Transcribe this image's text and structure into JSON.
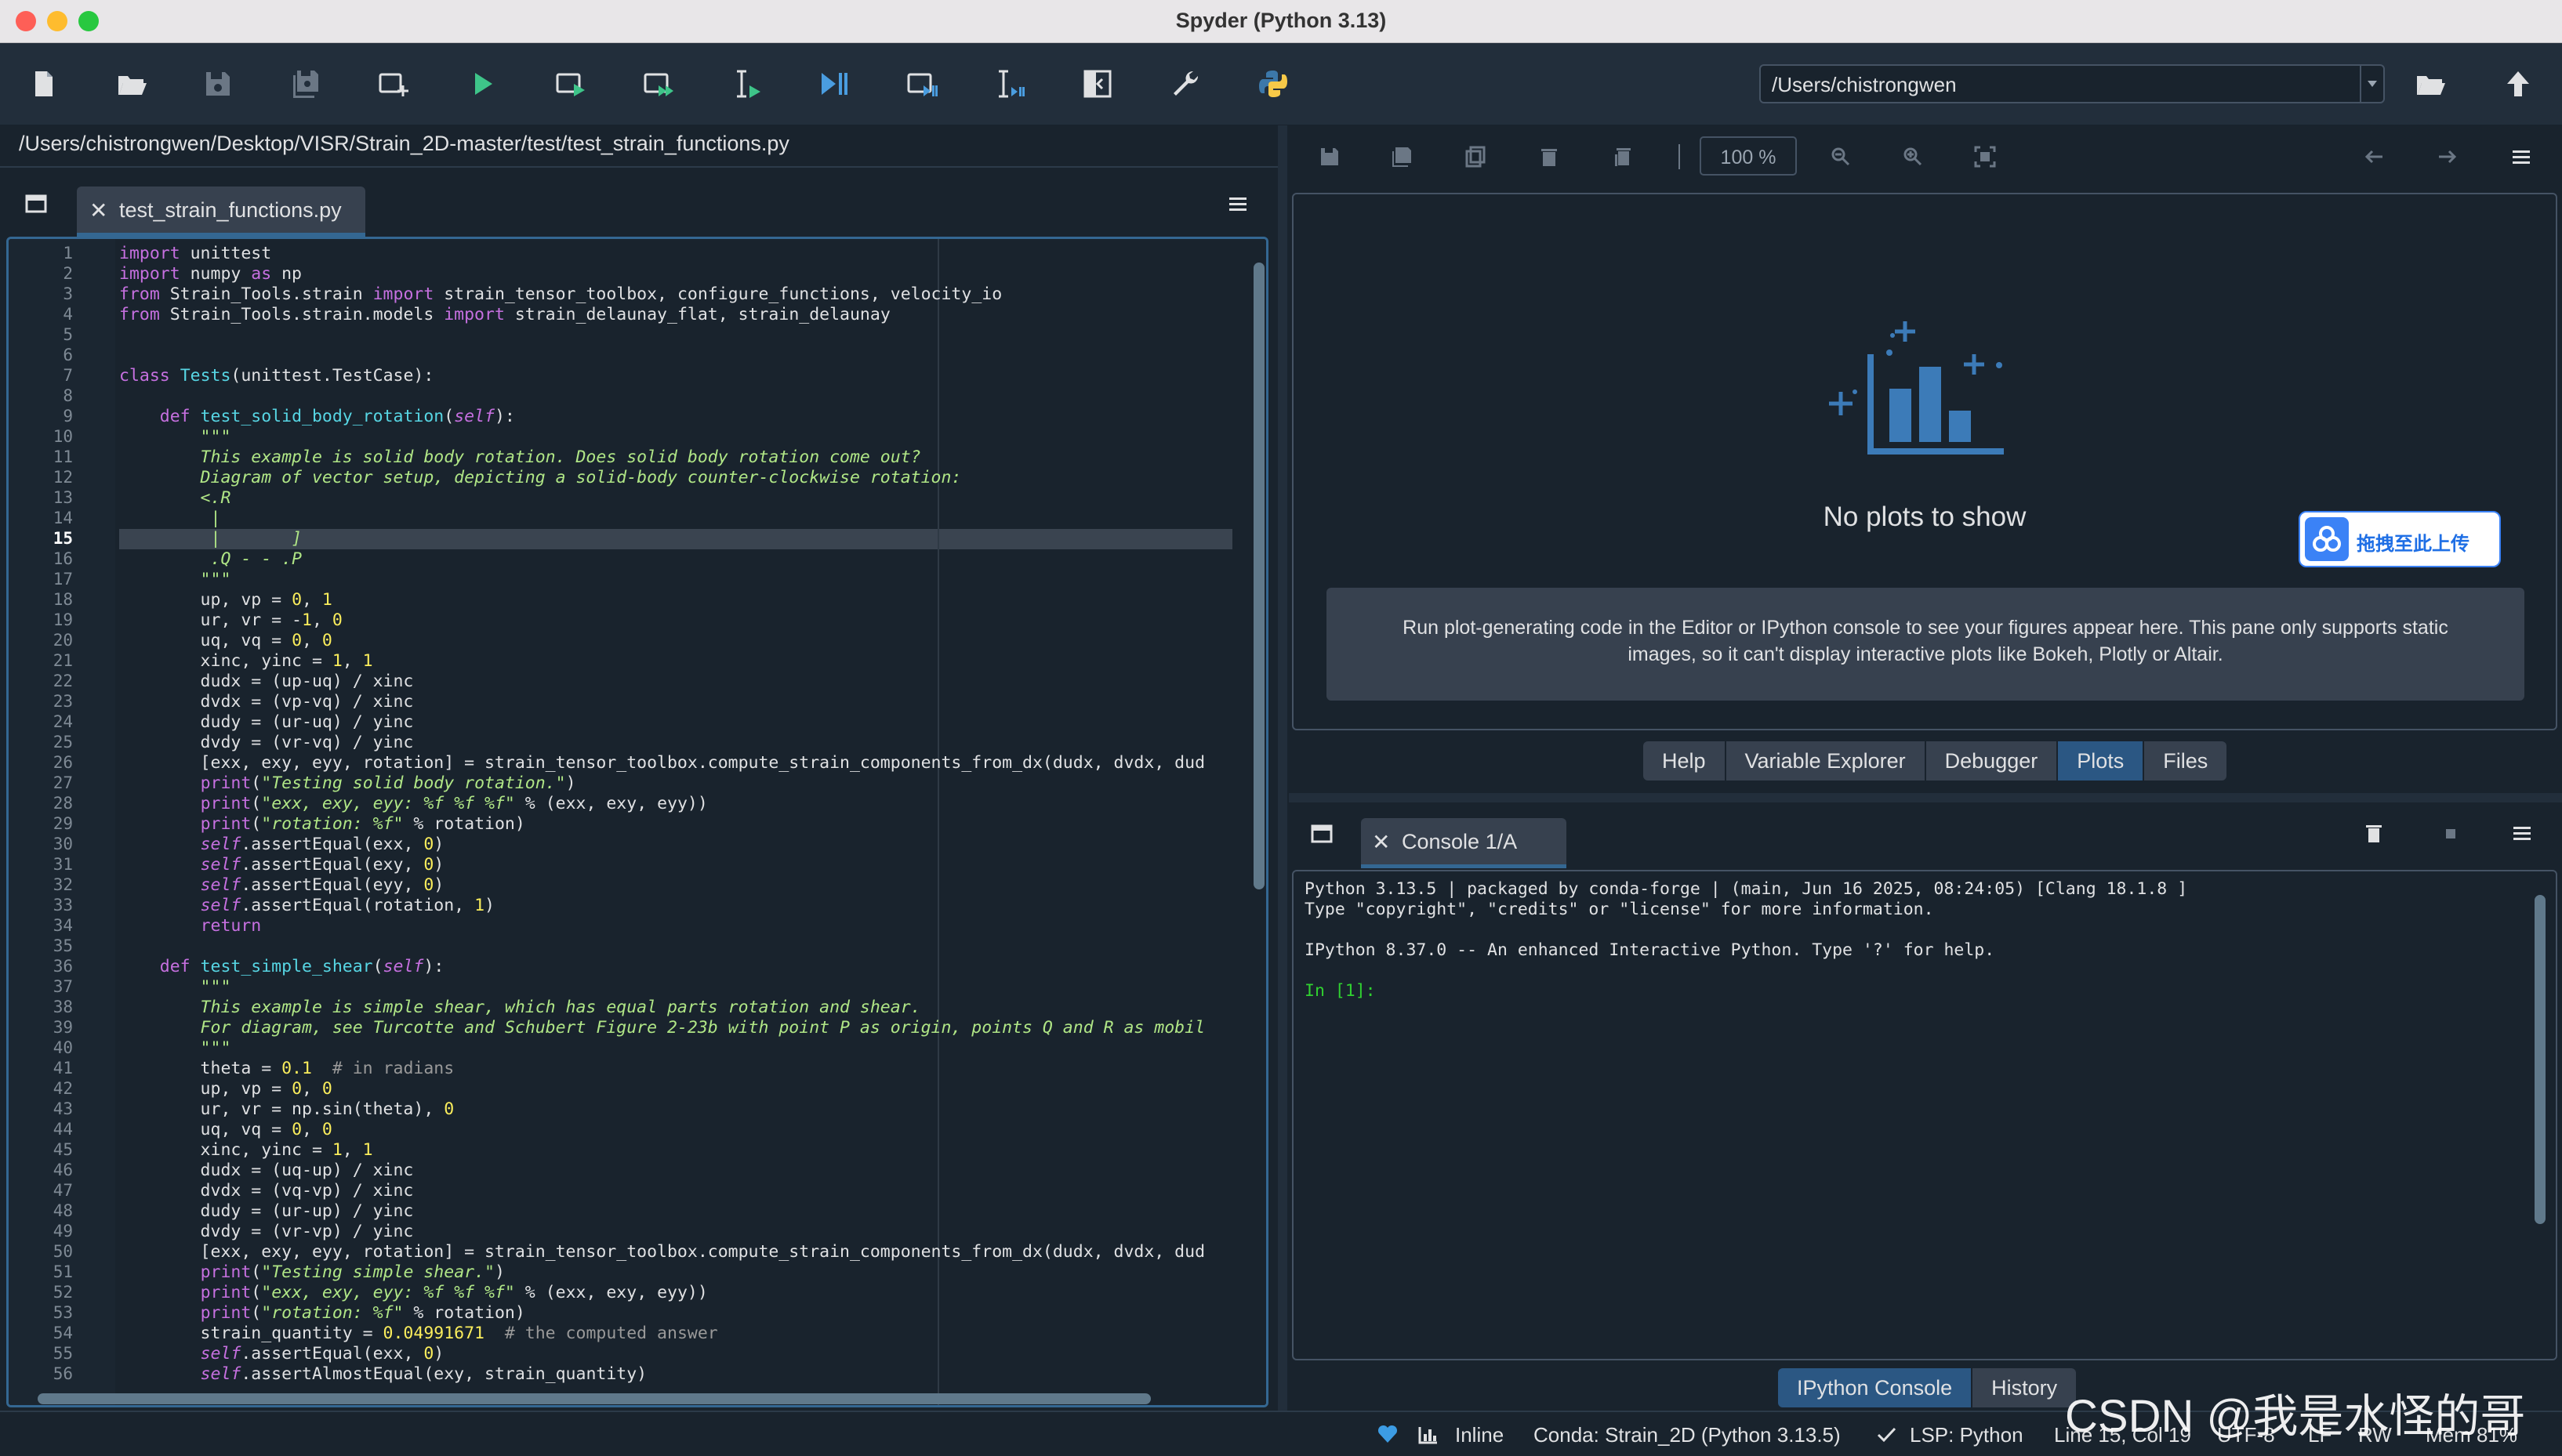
{
  "window": {
    "title": "Spyder (Python 3.13)"
  },
  "toolbar": {
    "icons": [
      "new-file-icon",
      "open-file-icon",
      "save-icon",
      "save-all-icon",
      "new-cell-icon",
      "run-icon",
      "run-cell-icon",
      "run-cell-advance-icon",
      "run-selection-icon",
      "debug-icon",
      "debug-cell-icon",
      "debug-selection-icon",
      "maximize-pane-icon",
      "preferences-wrench-icon",
      "python-path-icon",
      "open-folder-icon",
      "parent-directory-icon"
    ],
    "working_dir": "/Users/chistrongwen"
  },
  "editor": {
    "file_path": "/Users/chistrongwen/Desktop/VISR/Strain_2D-master/test/test_strain_functions.py",
    "tab_label": "test_strain_functions.py",
    "tab_close": "✕",
    "current_line": 15,
    "lines": [
      "import unittest",
      "import numpy as np",
      "from Strain_Tools.strain import strain_tensor_toolbox, configure_functions, velocity_io",
      "from Strain_Tools.strain.models import strain_delaunay_flat, strain_delaunay",
      "",
      "",
      "class Tests(unittest.TestCase):",
      "",
      "    def test_solid_body_rotation(self):",
      "        \"\"\"",
      "        This example is solid body rotation. Does solid body rotation come out?",
      "        Diagram of vector setup, depicting a solid-body counter-clockwise rotation:",
      "        <.R",
      "         |",
      "         |       ]",
      "         .Q - - .P",
      "        \"\"\"",
      "        up, vp = 0, 1",
      "        ur, vr = -1, 0",
      "        uq, vq = 0, 0",
      "        xinc, yinc = 1, 1",
      "        dudx = (up-uq) / xinc",
      "        dvdx = (vp-vq) / xinc",
      "        dudy = (ur-uq) / yinc",
      "        dvdy = (vr-vq) / yinc",
      "        [exx, exy, eyy, rotation] = strain_tensor_toolbox.compute_strain_components_from_dx(dudx, dvdx, dud",
      "        print(\"Testing solid body rotation.\")",
      "        print(\"exx, exy, eyy: %f %f %f\" % (exx, exy, eyy))",
      "        print(\"rotation: %f\" % rotation)",
      "        self.assertEqual(exx, 0)",
      "        self.assertEqual(exy, 0)",
      "        self.assertEqual(eyy, 0)",
      "        self.assertEqual(rotation, 1)",
      "        return",
      "",
      "    def test_simple_shear(self):",
      "        \"\"\"",
      "        This example is simple shear, which has equal parts rotation and shear.",
      "        For diagram, see Turcotte and Schubert Figure 2-23b with point P as origin, points Q and R as mobil",
      "        \"\"\"",
      "        theta = 0.1  # in radians",
      "        up, vp = 0, 0",
      "        ur, vr = np.sin(theta), 0",
      "        uq, vq = 0, 0",
      "        xinc, yinc = 1, 1",
      "        dudx = (uq-up) / xinc",
      "        dvdx = (vq-vp) / xinc",
      "        dudy = (ur-up) / yinc",
      "        dvdy = (vr-vp) / yinc",
      "        [exx, exy, eyy, rotation] = strain_tensor_toolbox.compute_strain_components_from_dx(dudx, dvdx, dud",
      "        print(\"Testing simple shear.\")",
      "        print(\"exx, exy, eyy: %f %f %f\" % (exx, exy, eyy))",
      "        print(\"rotation: %f\" % rotation)",
      "        strain_quantity = 0.04991671  # the computed answer",
      "        self.assertEqual(exx, 0)",
      "        self.assertAlmostEqual(exy, strain_quantity)"
    ]
  },
  "plots": {
    "zoom": "100 %",
    "empty_title": "No plots to show",
    "empty_message": "Run plot-generating code in the Editor or IPython console to see your figures appear here. This pane only supports static images, so it can't display interactive plots like Bokeh, Plotly or Altair.",
    "upload_button": "拖拽至此上传",
    "tabs": [
      "Help",
      "Variable Explorer",
      "Debugger",
      "Plots",
      "Files"
    ],
    "selected_tab": "Plots"
  },
  "console": {
    "tab_label": "Console 1/A",
    "tab_close": "✕",
    "lines": [
      "Python 3.13.5 | packaged by conda-forge | (main, Jun 16 2025, 08:24:05) [Clang 18.1.8 ]",
      "Type \"copyright\", \"credits\" or \"license\" for more information.",
      "",
      "IPython 8.37.0 -- An enhanced Interactive Python. Type '?' for help.",
      "",
      "In [1]:"
    ],
    "tabs": [
      "IPython Console",
      "History"
    ],
    "selected_tab": "IPython Console"
  },
  "status": {
    "inline": "Inline",
    "conda": "Conda: Strain_2D (Python 3.13.5)",
    "lsp": "LSP: Python",
    "position": "Line 15, Col 19",
    "encoding": "UTF-8",
    "eol": "LF",
    "rw": "RW",
    "mem": "Mem 81%"
  },
  "watermark": "CSDN @我是水怪的哥",
  "colors": {
    "background": "#19232d",
    "accent": "#346792",
    "selected_tab": "#2b5783",
    "keyword": "#c670e0",
    "string": "#b0e686",
    "number": "#faed5c",
    "function": "#57d6e4"
  }
}
